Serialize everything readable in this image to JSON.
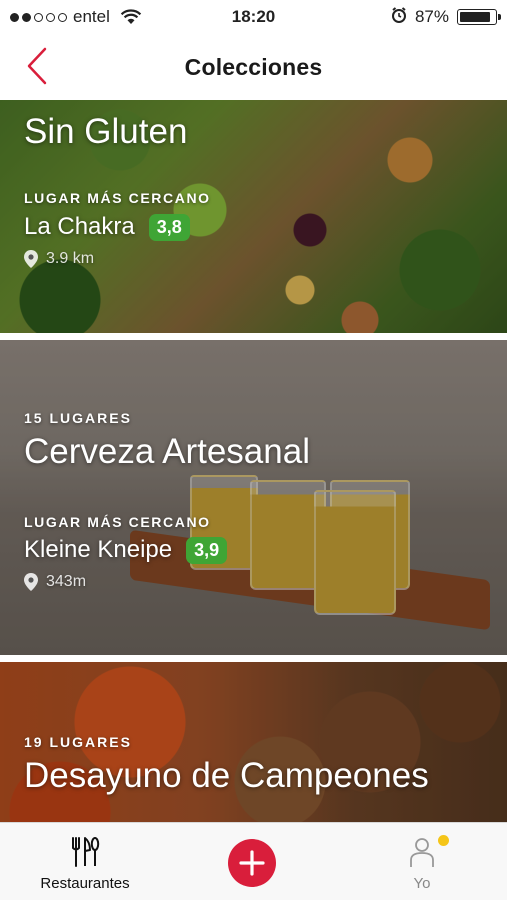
{
  "status": {
    "carrier": "entel",
    "time": "18:20",
    "battery": "87%",
    "battery_level": 0.87
  },
  "nav": {
    "title": "Colecciones",
    "back_icon": "chevron-left-icon",
    "accent_color": "#d91e3b"
  },
  "collections": [
    {
      "count": "",
      "title": "Sin Gluten",
      "nearest_label": "LUGAR MÁS CERCANO",
      "nearest_place": "La Chakra",
      "rating": "3,8",
      "distance": "3.9 km"
    },
    {
      "count": "15 LUGARES",
      "title": "Cerveza Artesanal",
      "nearest_label": "LUGAR MÁS CERCANO",
      "nearest_place": "Kleine Kneipe",
      "rating": "3,9",
      "distance": "343m"
    },
    {
      "count": "19 LUGARES",
      "title": "Desayuno de Campeones"
    }
  ],
  "tabs": {
    "restaurants": "Restaurantes",
    "yo": "Yo"
  },
  "colors": {
    "rating_badge": "#3fa535",
    "add_button": "#d91e3b",
    "notification_dot": "#f5c518"
  }
}
